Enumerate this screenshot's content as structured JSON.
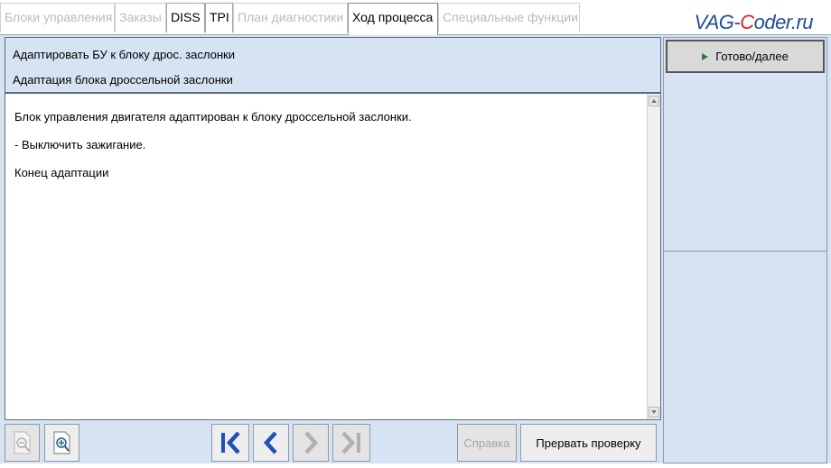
{
  "tabs": [
    {
      "label": "Блоки управления",
      "state": "disabled"
    },
    {
      "label": "Заказы",
      "state": "disabled"
    },
    {
      "label": "DISS",
      "state": "enabled"
    },
    {
      "label": "TPI",
      "state": "enabled"
    },
    {
      "label": "План диагностики",
      "state": "disabled"
    },
    {
      "label": "Ход процесса",
      "state": "active"
    },
    {
      "label": "Специальные функции",
      "state": "disabled"
    }
  ],
  "logo": {
    "pre": "VAG-",
    "accent": "C",
    "post": "oder.ru"
  },
  "header": {
    "line1": "Адаптировать БУ к блоку дрос. заслонки",
    "line2": "Адаптация блока дроссельной заслонки"
  },
  "content": {
    "lines": [
      "Блок управления двигателя адаптирован к блоку дроссельной заслонки.",
      "- Выключить зажигание.",
      "Конец адаптации"
    ]
  },
  "right_panel": {
    "done_label": "Готово/далее"
  },
  "toolbar": {
    "help_label": "Справка",
    "abort_label": "Прервать проверку"
  },
  "colors": {
    "background": "#d6e3f2",
    "nav_blue": "#1f4fb8",
    "disabled_gray": "#a5a5a5",
    "play_green": "#2e7d32",
    "logo_blue": "#1f4f99",
    "logo_red": "#d8261c"
  },
  "icons": [
    "zoom-out-icon",
    "zoom-in-icon",
    "first-page-icon",
    "previous-page-icon",
    "next-page-icon",
    "last-page-icon",
    "play-icon",
    "scroll-up-icon",
    "scroll-down-icon"
  ]
}
